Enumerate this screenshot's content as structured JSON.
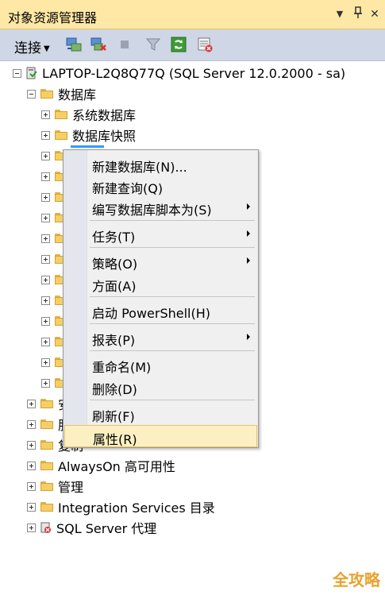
{
  "window": {
    "title": "对象资源管理器",
    "dropdown_glyph": "▼",
    "pin_glyph": "卩",
    "close_glyph": "✕"
  },
  "toolbar": {
    "connect_label": "连接",
    "connect_caret": "▼"
  },
  "tree": {
    "server": "LAPTOP-L2Q8Q77Q (SQL Server 12.0.2000 - sa)",
    "databases": "数据库",
    "system_db": "系统数据库",
    "db_snapshots": "数据库快照",
    "security_partial": "安",
    "server_objects_partial": "服",
    "replication_partial": "复制",
    "alwayson": "AlwaysOn 高可用性",
    "management": "管理",
    "integration": "Integration Services 目录",
    "agent": "SQL Server 代理"
  },
  "context_menu": {
    "items": [
      {
        "label": "新建数据库(N)..."
      },
      {
        "label": "新建查询(Q)"
      },
      {
        "label": "编写数据库脚本为(S)"
      },
      {
        "label": "任务(T)"
      },
      {
        "label": "策略(O)"
      },
      {
        "label": "方面(A)"
      },
      {
        "label": "启动 PowerShell(H)"
      },
      {
        "label": "报表(P)"
      },
      {
        "label": "重命名(M)"
      },
      {
        "label": "删除(D)"
      },
      {
        "label": "刷新(F)"
      },
      {
        "label": "属性(R)"
      }
    ]
  },
  "watermark": "全攻略",
  "colors": {
    "titlebar_bg": "#ffe8a6",
    "toolbar_bg": "#cfd6e5",
    "menu_bg": "#f0f0f0",
    "highlight_bg": "#fcf0c2",
    "folder": "#f5cf63",
    "watermark": "#e8a22e"
  }
}
